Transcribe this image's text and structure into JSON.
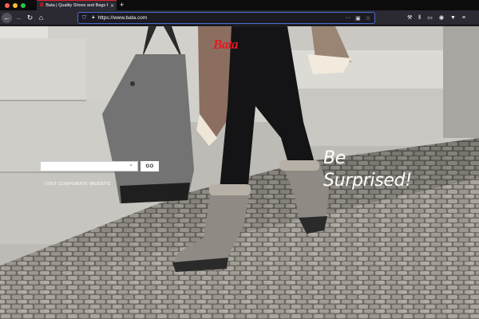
{
  "browser": {
    "tab": {
      "title": "Bata | Quality Shoes and Bags f",
      "favicon": "Bata"
    },
    "url": "https://www.bata.com",
    "icons": [
      "back-icon",
      "forward-icon",
      "reload-icon",
      "home-icon",
      "shield-icon",
      "lock-icon",
      "more-icon",
      "pocket-icon",
      "star-icon",
      "tools-icon",
      "library-icon",
      "sidebar-icon",
      "account-icon",
      "extension-icon",
      "menu-icon"
    ]
  },
  "hero": {
    "logo_text": "Bata",
    "tagline_line1": "Be",
    "tagline_line2": "Surprised!",
    "country_select": {
      "value": ""
    },
    "go_label": "GO",
    "corporate_link": "VISIT CORPORATE WEBSITE"
  },
  "colors": {
    "brand_red": "#e31b23",
    "tab_accent": "#e61e2a",
    "url_border": "#4a6ac8"
  }
}
